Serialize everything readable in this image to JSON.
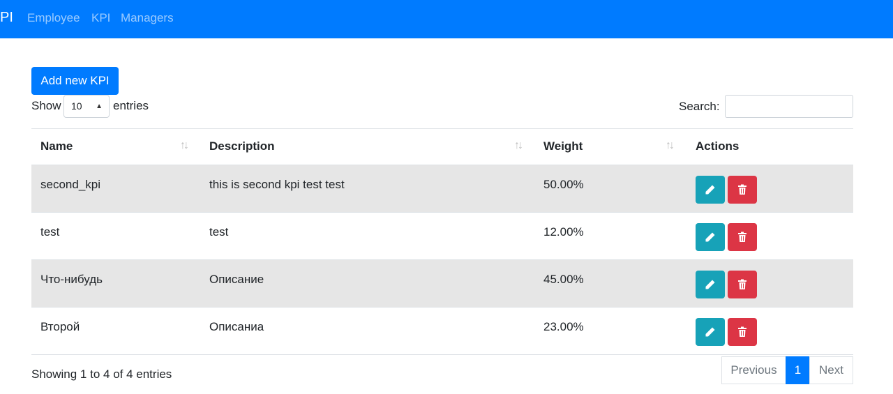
{
  "navbar": {
    "brand": "PI",
    "links": [
      "Employee",
      "KPI",
      "Managers"
    ]
  },
  "toolbar": {
    "add_label": "Add new KPI",
    "show_label": "Show",
    "page_length": "10",
    "entries_label": "entries",
    "search_label": "Search:",
    "search_value": ""
  },
  "table": {
    "headers": [
      "Name",
      "Description",
      "Weight",
      "Actions"
    ],
    "rows": [
      {
        "name": "second_kpi",
        "description": "this is second kpi test test",
        "weight": "50.00%"
      },
      {
        "name": "test",
        "description": "test",
        "weight": "12.00%"
      },
      {
        "name": "Что-нибудь",
        "description": "Описание",
        "weight": "45.00%"
      },
      {
        "name": "Второй",
        "description": "Описаниа",
        "weight": "23.00%"
      }
    ]
  },
  "footer": {
    "info": "Showing 1 to 4 of 4 entries",
    "previous": "Previous",
    "current_page": "1",
    "next": "Next"
  },
  "colors": {
    "primary": "#007bff",
    "edit": "#17a2b8",
    "delete": "#dc3545",
    "stripe": "#e6e6e6"
  },
  "icons": {
    "edit": "pencil-icon",
    "delete": "trash-icon",
    "sort": "sort-arrows-icon"
  }
}
